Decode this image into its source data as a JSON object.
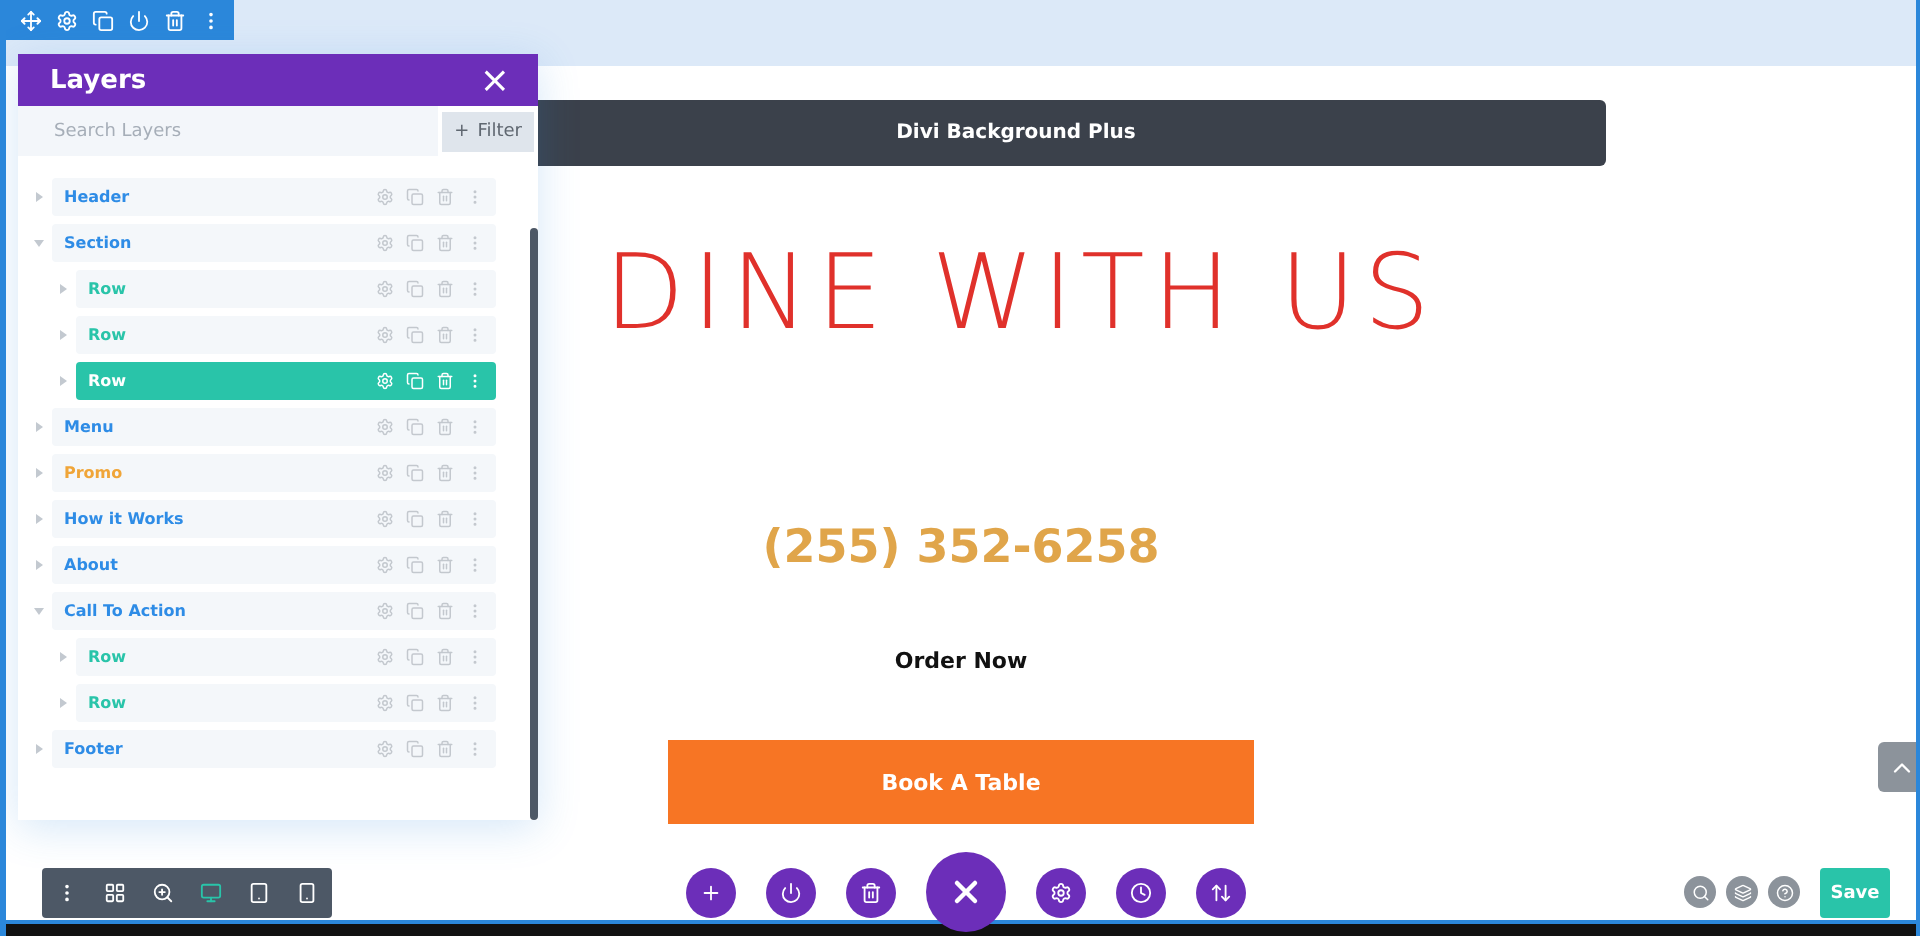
{
  "module_toolbar": {
    "actions": [
      {
        "kind": "move"
      },
      {
        "kind": "settings"
      },
      {
        "kind": "duplicate"
      },
      {
        "kind": "power"
      },
      {
        "kind": "delete"
      },
      {
        "kind": "more"
      }
    ]
  },
  "page": {
    "banner": "Divi Background Plus",
    "heading": "DINE WITH US",
    "phone": "(255) 352-6258",
    "link": "Order Now",
    "button": "Book A Table"
  },
  "layers": {
    "title": "Layers",
    "close": "×",
    "search": {
      "placeholder": "Search Layers"
    },
    "filter": "Filter",
    "filter_icon": "+",
    "items": [
      {
        "label": "Header",
        "color": "#2e8ce6",
        "expanded": false,
        "selected": false
      },
      {
        "label": "Section",
        "color": "#2e8ce6",
        "expanded": true,
        "selected": false,
        "children": [
          {
            "label": "Row",
            "color": "#29c4a9",
            "expanded": false,
            "selected": false
          },
          {
            "label": "Row",
            "color": "#29c4a9",
            "expanded": false,
            "selected": false
          },
          {
            "label": "Row",
            "expanded": false,
            "selected": true
          }
        ]
      },
      {
        "label": "Menu",
        "color": "#2e8ce6",
        "expanded": false,
        "selected": false
      },
      {
        "label": "Promo",
        "color": "#f0a538",
        "expanded": false,
        "selected": false
      },
      {
        "label": "How it Works",
        "color": "#2e8ce6",
        "expanded": false,
        "selected": false
      },
      {
        "label": "About",
        "color": "#2e8ce6",
        "expanded": false,
        "selected": false
      },
      {
        "label": "Call To Action",
        "color": "#2e8ce6",
        "expanded": true,
        "selected": false,
        "children": [
          {
            "label": "Row",
            "color": "#29c4a9",
            "expanded": false,
            "selected": false
          },
          {
            "label": "Row",
            "color": "#29c4a9",
            "expanded": false,
            "selected": false
          }
        ]
      },
      {
        "label": "Footer",
        "color": "#2e8ce6",
        "expanded": false,
        "selected": false
      }
    ]
  },
  "view_modes": [
    {
      "kind": "menu",
      "selected": false
    },
    {
      "kind": "wireframe",
      "selected": false
    },
    {
      "kind": "zoom",
      "selected": false
    },
    {
      "kind": "desktop",
      "selected": true
    },
    {
      "kind": "tablet",
      "selected": false
    },
    {
      "kind": "phone",
      "selected": false
    }
  ],
  "page_actions": [
    {
      "kind": "add"
    },
    {
      "kind": "power"
    },
    {
      "kind": "delete"
    },
    {
      "kind": "close"
    },
    {
      "kind": "settings"
    },
    {
      "kind": "history"
    },
    {
      "kind": "sort"
    }
  ],
  "help_actions": [
    {
      "kind": "search"
    },
    {
      "kind": "layers"
    },
    {
      "kind": "help"
    }
  ],
  "save": "Save"
}
